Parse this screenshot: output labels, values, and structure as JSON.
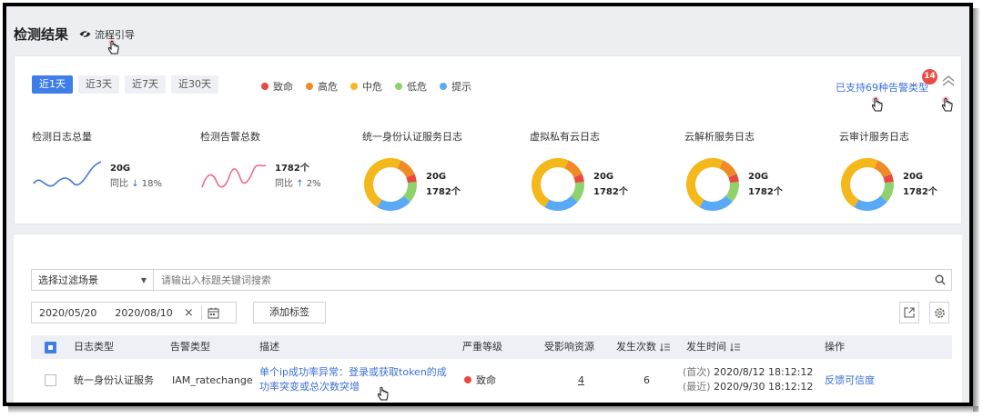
{
  "header": {
    "title": "检测结果",
    "guide_label": "流程引导"
  },
  "time_tabs": [
    {
      "label": "近1天",
      "active": true
    },
    {
      "label": "近3天",
      "active": false
    },
    {
      "label": "近7天",
      "active": false
    },
    {
      "label": "近30天",
      "active": false
    }
  ],
  "severity_legend": [
    {
      "label": "致命",
      "color": "#e8483f"
    },
    {
      "label": "高危",
      "color": "#f08a24"
    },
    {
      "label": "中危",
      "color": "#f5b81b"
    },
    {
      "label": "低危",
      "color": "#8fd16c"
    },
    {
      "label": "提示",
      "color": "#5aa9f5"
    }
  ],
  "support": {
    "label": "已支持69种告警类型",
    "badge": "14"
  },
  "metrics": {
    "log_total": {
      "title": "检测日志总量",
      "value": "20G",
      "compare_label": "同比",
      "change": "18%"
    },
    "alert_total": {
      "title": "检测告警总数",
      "value": "1782个",
      "compare_label": "同比",
      "change": "2%"
    },
    "donuts": [
      {
        "title": "统一身份认证服务日志",
        "size": "20G",
        "count": "1782个"
      },
      {
        "title": "虚拟私有云日志",
        "size": "20G",
        "count": "1782个"
      },
      {
        "title": "云解析服务日志",
        "size": "20G",
        "count": "1782个"
      },
      {
        "title": "云审计服务日志",
        "size": "20G",
        "count": "1782个"
      }
    ]
  },
  "filters": {
    "scenario_label": "选择过滤场景",
    "search_placeholder": "请输出入标题关键词搜索",
    "date_from": "2020/05/20",
    "date_to": "2020/08/10",
    "add_tag_label": "添加标签"
  },
  "table": {
    "columns": [
      "日志类型",
      "告警类型",
      "描述",
      "严重等级",
      "受影响资源",
      "发生次数",
      "发生时间",
      "操作"
    ],
    "rows": [
      {
        "log_type": "统一身份认证服务",
        "alert_type": "IAM_ratechange",
        "description": "单个ip成功率异常：登录或获取token的成功率突变或总次数突增",
        "severity": "致命",
        "resources": "4",
        "occurrences": "6",
        "first_label": "(首次)",
        "first_time": "2020/8/12 18:12:12",
        "last_label": "(最近)",
        "last_time": "2020/9/30 18:12:12",
        "action": "反馈可信度"
      }
    ]
  }
}
